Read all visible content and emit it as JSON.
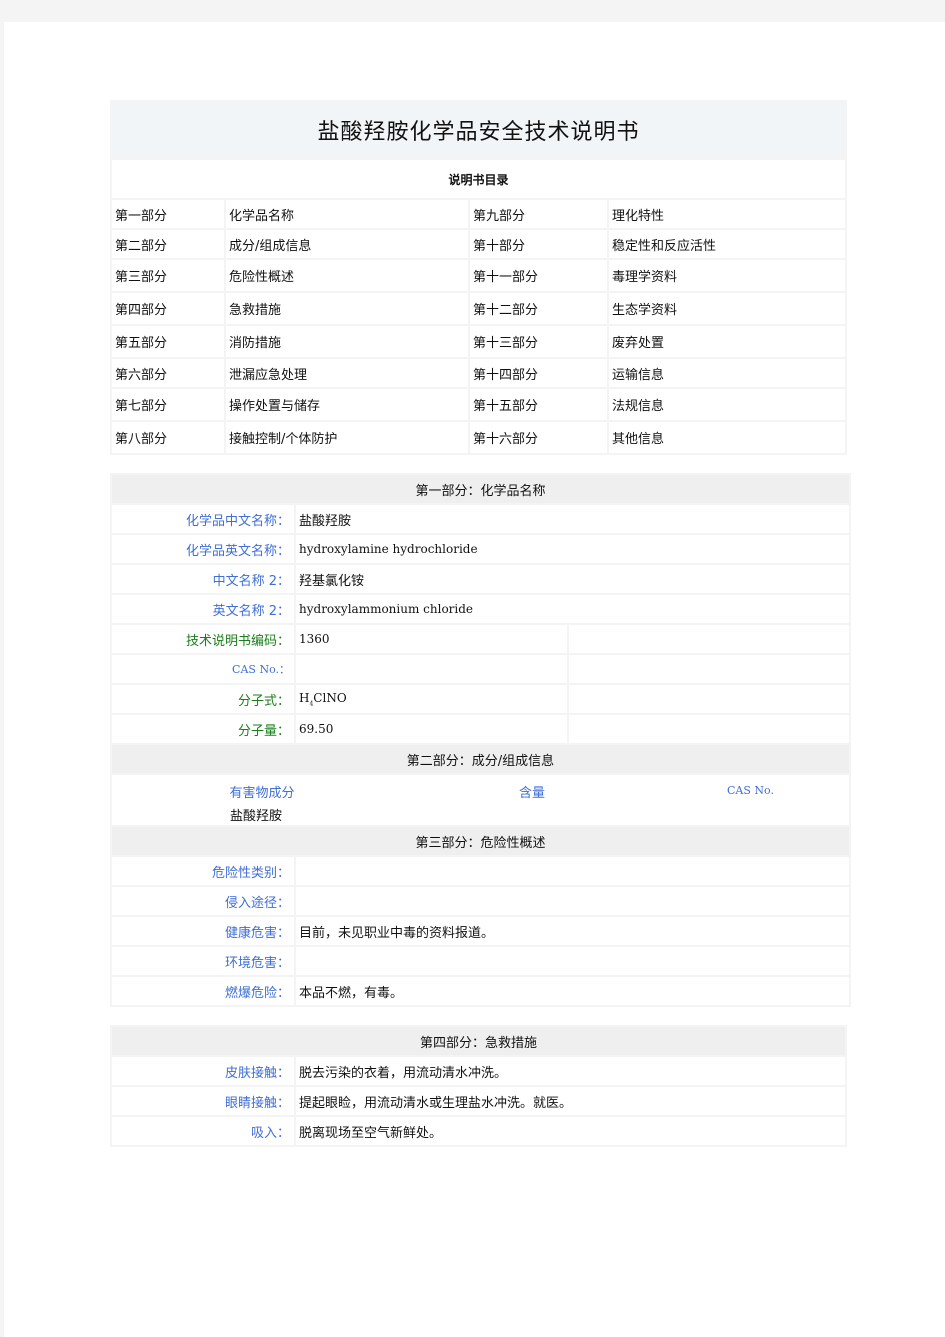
{
  "document": {
    "title": "盐酸羟胺化学品安全技术说明书",
    "toc_heading": "说明书目录",
    "toc": [
      {
        "part": "第一部分",
        "name": "化学品名称",
        "part2": "第九部分",
        "name2": "理化特性"
      },
      {
        "part": "第二部分",
        "name": "成分/组成信息",
        "part2": "第十部分",
        "name2": "稳定性和反应活性"
      },
      {
        "part": "第三部分",
        "name": "危险性概述",
        "part2": "第十一部分",
        "name2": "毒理学资料"
      },
      {
        "part": "第四部分",
        "name": "急救措施",
        "part2": "第十二部分",
        "name2": "生态学资料"
      },
      {
        "part": "第五部分",
        "name": "消防措施",
        "part2": "第十三部分",
        "name2": "废弃处置"
      },
      {
        "part": "第六部分",
        "name": "泄漏应急处理",
        "part2": "第十四部分",
        "name2": "运输信息"
      },
      {
        "part": "第七部分",
        "name": "操作处置与储存",
        "part2": "第十五部分",
        "name2": "法规信息"
      },
      {
        "part": "第八部分",
        "name": "接触控制/个体防护",
        "part2": "第十六部分",
        "name2": "其他信息"
      }
    ]
  },
  "section1": {
    "heading": "第一部分：化学品名称",
    "cn_name_label": "化学品中文名称：",
    "cn_name": "盐酸羟胺",
    "en_name_label": "化学品英文名称：",
    "en_name": "hydroxylamine hydrochloride",
    "cn_name2_label": "中文名称 2：",
    "cn_name2": "羟基氯化铵",
    "en_name2_label": "英文名称 2：",
    "en_name2": "hydroxylammonium chloride",
    "code_label": "技术说明书编码：",
    "code": "1360",
    "cas_label": "CAS No.：",
    "cas": "",
    "formula_label": "分子式：",
    "formula_h": "H",
    "formula_sub": "4",
    "formula_rest": "ClNO",
    "mw_label": "分子量：",
    "mw": "69.50"
  },
  "section2": {
    "heading": "第二部分：成分/组成信息",
    "col_ingredient": "有害物成分",
    "col_content": "含量",
    "col_cas": "CAS No.",
    "ingredient": "盐酸羟胺",
    "content": "",
    "cas": ""
  },
  "section3": {
    "heading": "第三部分：危险性概述",
    "rows": [
      {
        "label": "危险性类别：",
        "value": ""
      },
      {
        "label": "侵入途径：",
        "value": ""
      },
      {
        "label": "健康危害：",
        "value": "目前，未见职业中毒的资料报道。"
      },
      {
        "label": "环境危害：",
        "value": ""
      },
      {
        "label": "燃爆危险：",
        "value": "本品不燃，有毒。"
      }
    ]
  },
  "section4": {
    "heading": "第四部分：急救措施",
    "rows": [
      {
        "label": "皮肤接触：",
        "value": "脱去污染的衣着，用流动清水冲洗。"
      },
      {
        "label": "眼睛接触：",
        "value": "提起眼睑，用流动清水或生理盐水冲洗。就医。"
      },
      {
        "label": "吸入：",
        "value": "脱离现场至空气新鲜处。"
      }
    ]
  },
  "colors": {
    "label_blue": "#3f6ed6",
    "label_green": "#1a7f1a",
    "title_bg": "#f1f5f8",
    "section_bg": "#efefef"
  }
}
